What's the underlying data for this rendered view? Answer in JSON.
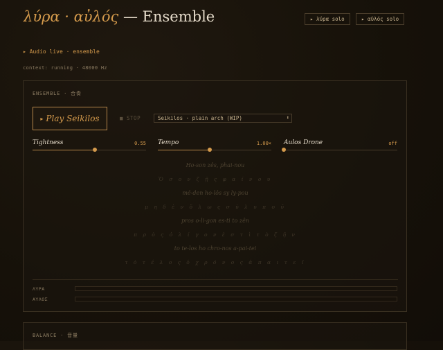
{
  "header": {
    "title_greek": "λύρα · αὐλός",
    "title_suffix": " — Ensemble",
    "buttons": [
      {
        "label": "▸ λύρα solo"
      },
      {
        "label": "▸ αὐλός solo"
      }
    ]
  },
  "status": {
    "audio": "▸ Audio live · ensemble",
    "context": "context: running · 48000 Hz"
  },
  "ensemble": {
    "label": "ENSEMBLE · 合奏",
    "play_label": "Play Seikilos",
    "stop_label": "■ STOP",
    "select_value": "Seikilos · plain arch (WIP)",
    "sliders": [
      {
        "label": "Tightness",
        "value_text": "0.55",
        "level": 0.55
      },
      {
        "label": "Tempo",
        "value_text": "1.00×",
        "level": 0.46
      },
      {
        "label": "Aulos Drone",
        "value_text": "off",
        "level": 0
      }
    ],
    "lyrics": [
      "Ho-son zês, phai-nou",
      "Ὅ σ ο ν   ζ ῇ ς   φ α ί ν ο υ",
      "mê-den ho-lôs sy ly-pou",
      "μ η δ ὲ ν   ὅ λ ω ς   σ ὺ   λ υ π ο ῦ",
      "pros o-li-gon es-ti to zên",
      "π ρ ὸ ς   ὀ λ ί γ ο ν   ἐ σ τ ὶ   τ ὸ   ζ ῆ ν",
      "to te-los ho chro-nos a-pai-tei",
      "τ ὸ   τ έ λ ο ς   ὁ   χ ρ ό ν ο ς   ἀ π α ι τ ε ῖ"
    ],
    "meters": [
      {
        "label": "ΛΥΡΑ",
        "level": 0
      },
      {
        "label": "ΑΥΛΟΣ",
        "level": 0
      }
    ]
  },
  "balance": {
    "label": "BALANCE · 音量"
  },
  "colors": {
    "accent": "#d49a4c",
    "background": "#161109",
    "text": "#e6dccb"
  }
}
